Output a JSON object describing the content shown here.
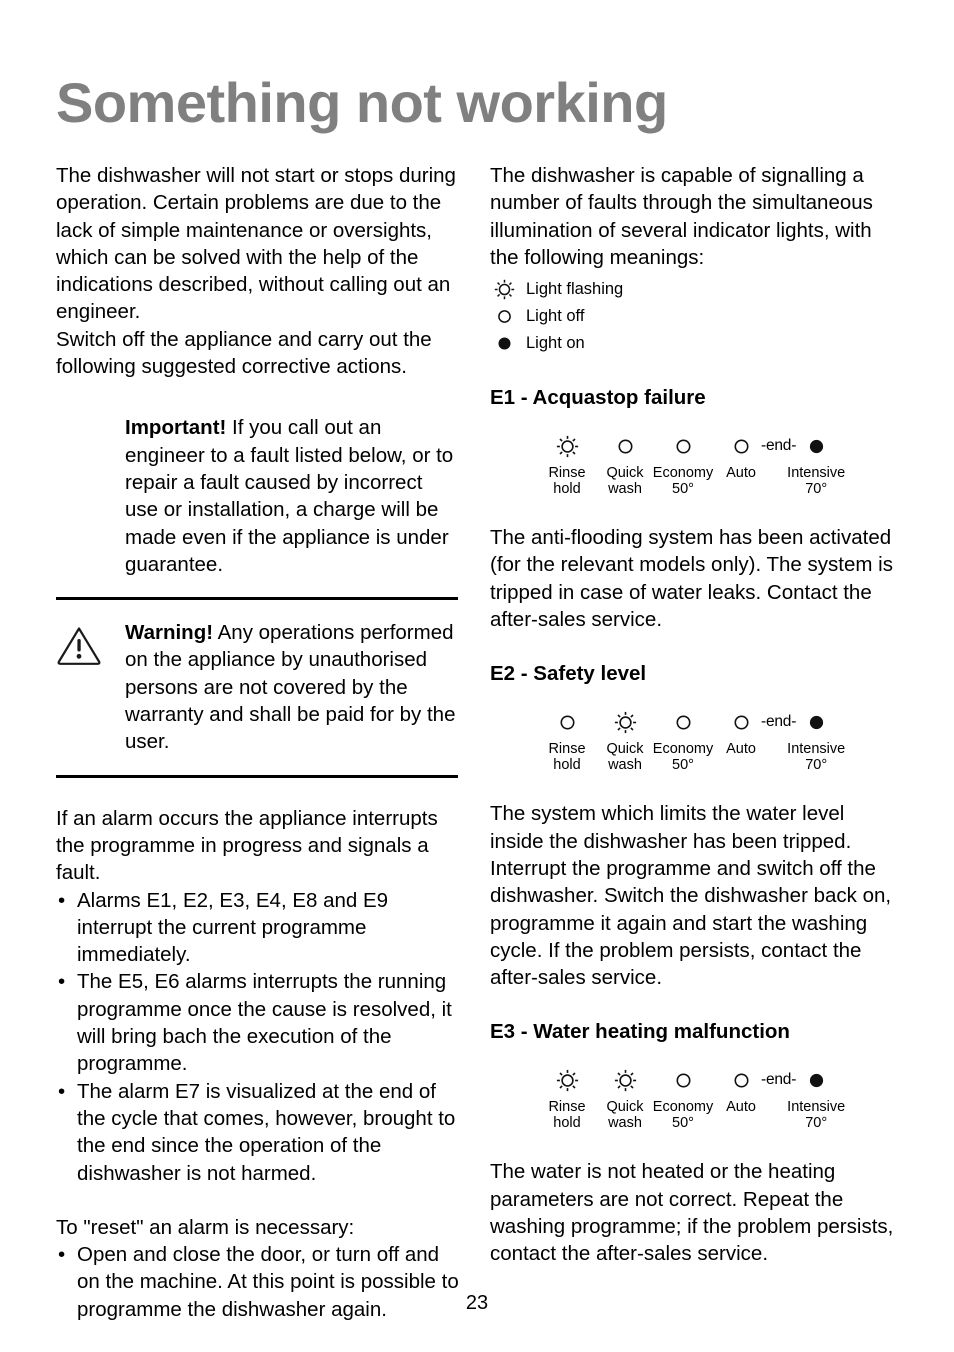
{
  "title": "Something not working",
  "page_number": "23",
  "left_column": {
    "intro_paragraph": "The dishwasher will not start or stops during operation. Certain problems are due to the lack of simple maintenance or oversights, which can be solved with the help of the indications described, without calling out an engineer.",
    "intro_paragraph2": "Switch off the appliance and carry out the following suggested corrective actions.",
    "important": {
      "label": "Important!",
      "text": " If you call out an engineer to a fault listed below, or to repair a fault caused by incorrect use or installation, a charge will be made even if the appliance is under guarantee."
    },
    "warning": {
      "icon": "warning-triangle-icon",
      "label": "Warning!",
      "text": " Any operations performed on the appliance by unauthorised persons are not covered by the warranty and shall be paid for by the user."
    },
    "alarm_intro": "If an alarm occurs the appliance interrupts the programme in progress and signals a fault.",
    "alarm_bullets": [
      "Alarms E1, E2, E3, E4, E8 and E9 interrupt the current programme immediately.",
      "The E5, E6 alarms interrupts the running programme once the cause is resolved, it will bring bach the execution of the programme.",
      "The alarm E7 is visualized at the end of the cycle that comes, however, brought to the end since the operation of the dishwasher is not harmed."
    ],
    "reset_intro": "To \"reset\" an alarm is necessary:",
    "reset_bullets": [
      "Open and close the door, or turn off and on the machine. At this point is possible to programme the dishwasher again."
    ]
  },
  "right_column": {
    "intro_paragraph": "The dishwasher is capable of signalling a number of faults through the simultaneous illumination of several indicator lights, with the following meanings:",
    "legend": [
      {
        "symbol": "flashing",
        "icon": "light-flashing-icon",
        "label": "Light flashing"
      },
      {
        "symbol": "off",
        "icon": "light-off-icon",
        "label": "Light off"
      },
      {
        "symbol": "on",
        "icon": "light-on-icon",
        "label": "Light on"
      }
    ],
    "indicator_labels": [
      "Rinse\nhold",
      "Quick\nwash",
      "Economy\n50°",
      "Auto",
      "Intensive\n70°"
    ],
    "end_tag": "-end-",
    "errors": [
      {
        "heading": "E1 - Acquastop failure",
        "lights": [
          "flashing",
          "off",
          "off",
          "off",
          "on"
        ],
        "body": "The anti-flooding system has been activated (for the relevant models only). The system is tripped in case of water leaks. Contact the after-sales service."
      },
      {
        "heading": "E2 - Safety level",
        "lights": [
          "off",
          "flashing",
          "off",
          "off",
          "on"
        ],
        "body": "The system which limits the water level inside the dishwasher has been tripped. Interrupt the programme and switch off the dishwasher. Switch the dishwasher back on, programme it again and start the washing cycle. If the problem persists, contact the after-sales service."
      },
      {
        "heading": "E3 - Water heating malfunction",
        "lights": [
          "flashing",
          "flashing",
          "off",
          "off",
          "on"
        ],
        "body": "The water is not heated or the heating parameters are not correct. Repeat the washing programme; if the problem persists, contact the after-sales service."
      }
    ]
  },
  "colors": {
    "title_gray": "#808080",
    "text_black": "#000000",
    "background": "#ffffff"
  }
}
